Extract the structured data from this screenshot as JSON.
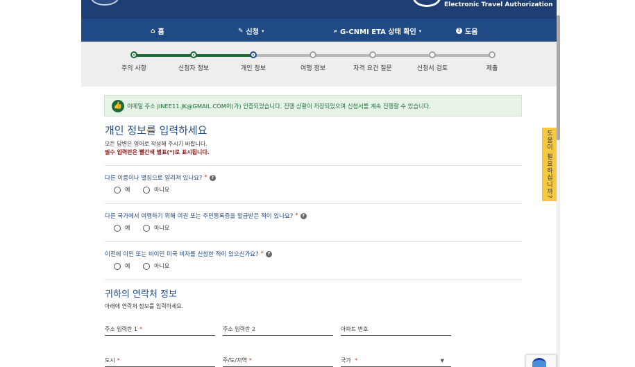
{
  "header": {
    "eta_title": "Electronic Travel Authorization"
  },
  "nav": {
    "items": [
      {
        "label": "홈",
        "icon": "home-icon"
      },
      {
        "label": "신청",
        "icon": "pencil-icon"
      },
      {
        "label": "G-CNMI ETA 상태 확인",
        "icon": "search-icon"
      },
      {
        "label": "도움",
        "icon": "question-icon"
      }
    ]
  },
  "steps": {
    "items": [
      {
        "label": "주의 사항",
        "state": "done"
      },
      {
        "label": "신청자 정보",
        "state": "done"
      },
      {
        "label": "개인 정보",
        "state": "current"
      },
      {
        "label": "여행 정보",
        "state": "todo"
      },
      {
        "label": "자격 요건 질문",
        "state": "todo"
      },
      {
        "label": "신청서 검토",
        "state": "todo"
      },
      {
        "label": "제출",
        "state": "todo"
      }
    ]
  },
  "alert": {
    "text": "이메일 주소 JINEE11.JK@GMAIL.COM이(가) 인증되었습니다. 진행 상황이 저장되었으며 신청서를 계속 진행할 수 있습니다."
  },
  "personal": {
    "title": "개인 정보를 입력하세요",
    "subtitle": "모든 답변은 영어로 작성해 주시기 바랍니다.",
    "required_note": "필수 입력란은 빨간색 별표(*)로 표시됩니다."
  },
  "questions": [
    {
      "text": "다른 이름이나 별칭으로 알려져 있나요?",
      "yes": "예",
      "no": "아니요"
    },
    {
      "text": "다른 국가에서 여행하기 위해 여권 또는 주민등록증을 발급받은 적이 있나요?",
      "yes": "예",
      "no": "아니요"
    },
    {
      "text": "이전에 이민 또는 비이민 미국 비자를 신청한 적이 있으신가요?",
      "yes": "예",
      "no": "아니요"
    }
  ],
  "contact": {
    "title": "귀하의 연락처 정보",
    "subtitle": "아래에 연락처 정보를 입력하세요.",
    "fields": {
      "address1": "주소 입력란 1",
      "address2": "주소 입력란 2",
      "apartment": "아파트 번호",
      "city": "도시",
      "state": "주/도/지역",
      "country": "국가"
    }
  },
  "help_tab": "도움이 필요하십니까?",
  "colors": {
    "navy": "#1f4a85",
    "green": "#1c6b37",
    "required": "#c0392b",
    "help_tab": "#f5c842"
  }
}
